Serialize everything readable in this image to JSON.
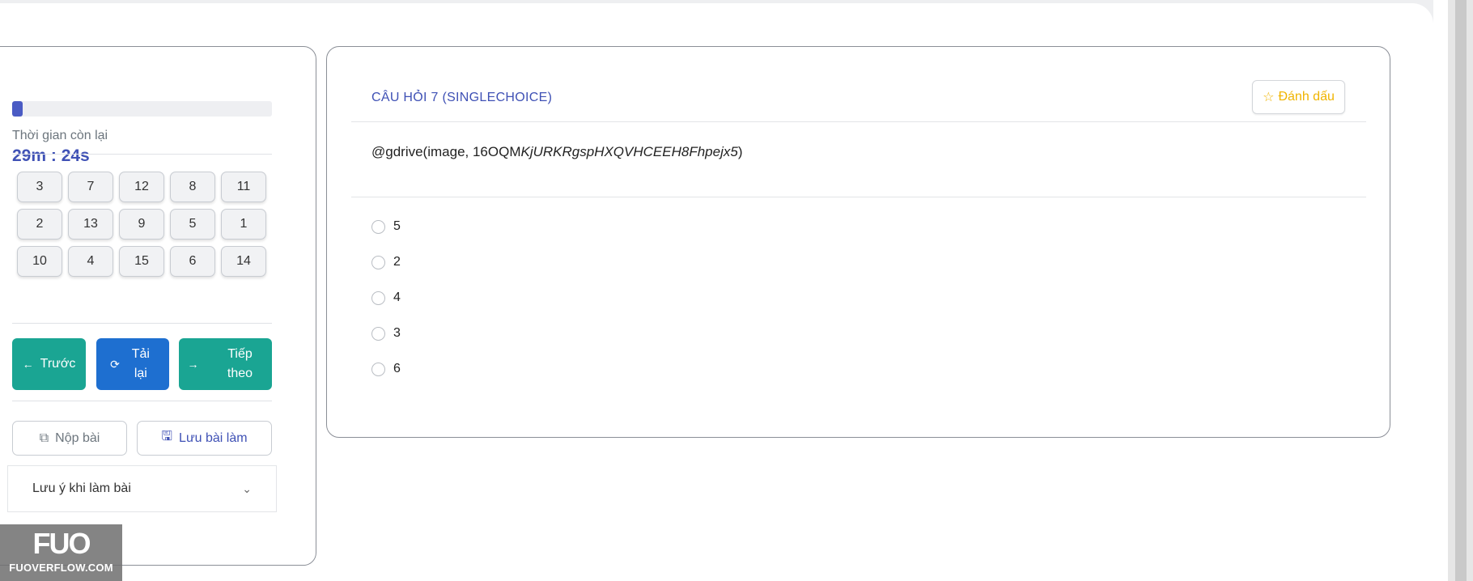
{
  "timer": {
    "label": "Thời gian còn lại",
    "value": "29m : 24s"
  },
  "progress": {
    "fraction": 0.04,
    "color": "#4a5bc4"
  },
  "question_nav": {
    "rows": [
      [
        "3",
        "7",
        "12",
        "8",
        "11"
      ],
      [
        "2",
        "13",
        "9",
        "5",
        "1"
      ],
      [
        "10",
        "4",
        "15",
        "6",
        "14"
      ]
    ]
  },
  "nav_buttons": {
    "prev": {
      "label": "Trước",
      "icon": "arrow-left-icon"
    },
    "reload": {
      "label": "Tải lại",
      "icon": "refresh-icon"
    },
    "next": {
      "label": "Tiếp theo",
      "icon": "arrow-right-icon"
    }
  },
  "actions": {
    "submit": {
      "label": "Nộp bài",
      "icon": "copy-icon"
    },
    "save": {
      "label": "Lưu bài làm",
      "icon": "save-icon"
    }
  },
  "notes": {
    "label": "Lưu ý khi làm bài",
    "icon": "chevron-down-icon"
  },
  "logo": {
    "mark": "FUO",
    "text": "FUOVERFLOW.COM"
  },
  "question": {
    "title": "CÂU HỎI 7 (SINGLECHOICE)",
    "mark_label": "Đánh dấu",
    "mark_icon": "star-outline-icon",
    "text_prefix": "@gdrive(image, 16OQM",
    "text_italic": "KjURKRgspHXQVHCEEH8Fhpejx5",
    "text_suffix": ")",
    "options": [
      "5",
      "2",
      "4",
      "3",
      "6"
    ]
  },
  "colors": {
    "primary": "#3f51b5",
    "teal": "#1aa593",
    "blue": "#1e6fd0",
    "star": "#f0b400"
  }
}
